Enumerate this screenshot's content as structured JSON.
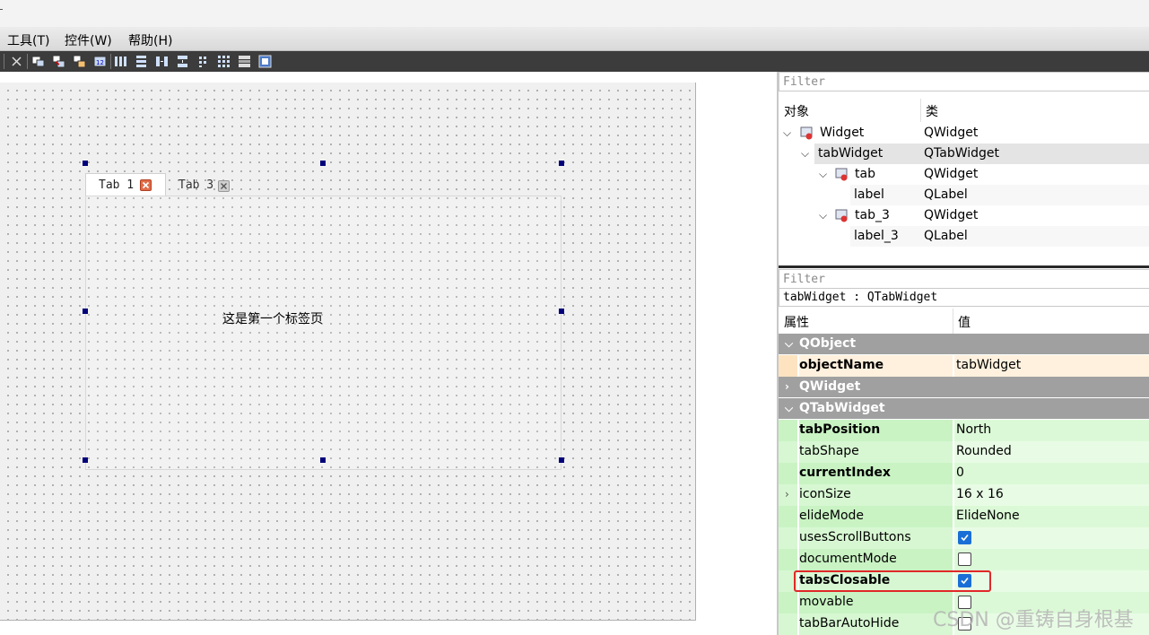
{
  "menu": {
    "items": [
      "工具(T)",
      "控件(W)",
      "帮助(H)"
    ]
  },
  "toolbar": {
    "icons": [
      "close-icon",
      "edit-widgets-icon",
      "edit-signals-icon",
      "edit-buddies-icon",
      "edit-tab-order-icon",
      "layout-horizontal-icon",
      "layout-vertical-icon",
      "layout-h-splitter-icon",
      "layout-v-splitter-icon",
      "layout-form-icon",
      "layout-grid-icon",
      "break-layout-icon",
      "adjust-size-icon"
    ]
  },
  "form": {
    "tabs": [
      {
        "label": "Tab 1",
        "active": true
      },
      {
        "label": "Tab 3",
        "active": false
      }
    ],
    "pane_text": "这是第一个标签页"
  },
  "object_inspector": {
    "filter_placeholder": "Filter",
    "col_object": "对象",
    "col_class": "类",
    "rows": [
      {
        "name": "Widget",
        "class": "QWidget"
      },
      {
        "name": "tabWidget",
        "class": "QTabWidget"
      },
      {
        "name": "tab",
        "class": "QWidget"
      },
      {
        "name": "label",
        "class": "QLabel"
      },
      {
        "name": "tab_3",
        "class": "QWidget"
      },
      {
        "name": "label_3",
        "class": "QLabel"
      }
    ]
  },
  "property_editor": {
    "filter_placeholder": "Filter",
    "target": "tabWidget : QTabWidget",
    "col_property": "属性",
    "col_value": "值",
    "groups": {
      "qobject": "QObject",
      "qwidget": "QWidget",
      "qtabwidget": "QTabWidget"
    },
    "props": {
      "objectName": {
        "name": "objectName",
        "value": "tabWidget"
      },
      "tabPosition": {
        "name": "tabPosition",
        "value": "North"
      },
      "tabShape": {
        "name": "tabShape",
        "value": "Rounded"
      },
      "currentIndex": {
        "name": "currentIndex",
        "value": "0"
      },
      "iconSize": {
        "name": "iconSize",
        "value": "16 x 16"
      },
      "elideMode": {
        "name": "elideMode",
        "value": "ElideNone"
      },
      "usesScrollButtons": {
        "name": "usesScrollButtons",
        "checked": true
      },
      "documentMode": {
        "name": "documentMode",
        "checked": false
      },
      "tabsClosable": {
        "name": "tabsClosable",
        "checked": true
      },
      "movable": {
        "name": "movable",
        "checked": false
      },
      "tabBarAutoHide": {
        "name": "tabBarAutoHide",
        "checked": false
      }
    }
  },
  "watermark": "CSDN @重铸自身根基",
  "colors": {
    "group_bg": "#a0a0a0",
    "highlight": "#e02828",
    "checkbox_checked": "#1a6fd6"
  }
}
